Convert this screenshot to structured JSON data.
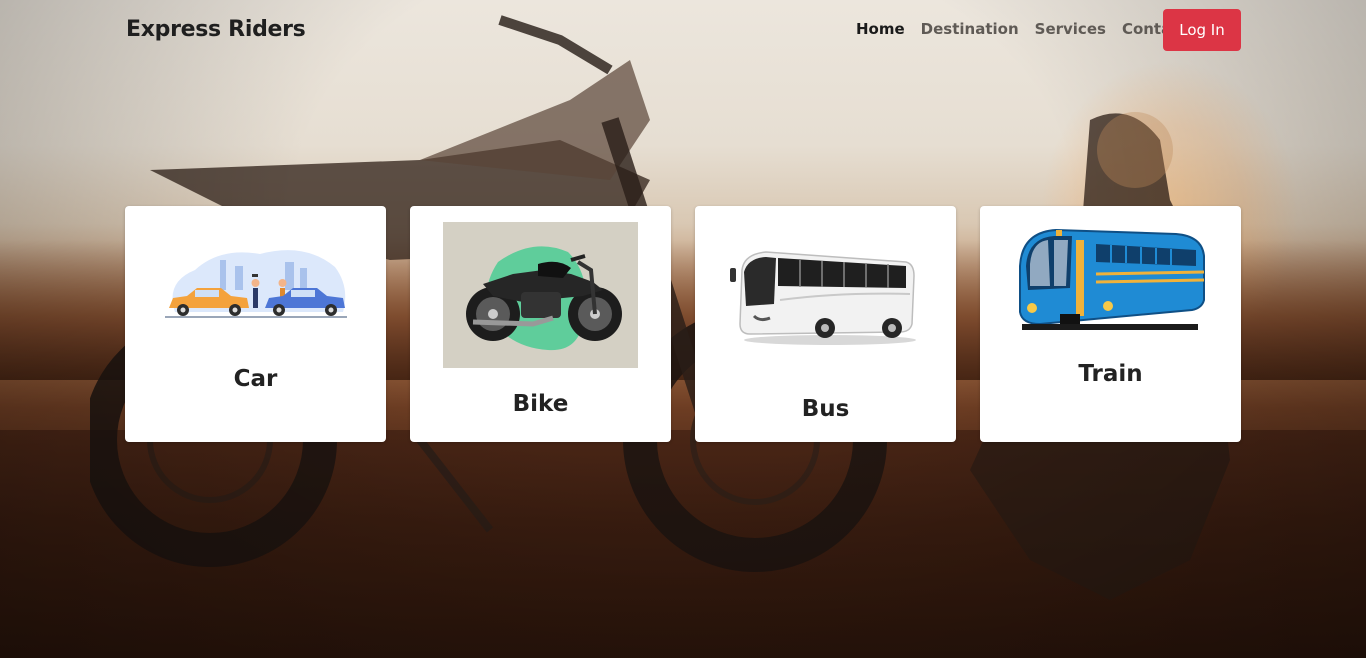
{
  "navbar": {
    "brand": "Express Riders",
    "links": [
      {
        "label": "Home",
        "active": true
      },
      {
        "label": "Destination",
        "active": false
      },
      {
        "label": "Services",
        "active": false
      },
      {
        "label": "Contact",
        "active": false
      }
    ],
    "login_label": "Log In"
  },
  "cards": [
    {
      "title": "Car",
      "icon": "car-illustration"
    },
    {
      "title": "Bike",
      "icon": "motorbike-illustration"
    },
    {
      "title": "Bus",
      "icon": "bus-illustration"
    },
    {
      "title": "Train",
      "icon": "train-illustration"
    }
  ],
  "colors": {
    "accent": "#dc3545",
    "brand_text": "#1f1f1f",
    "nav_text": "#5f5a55",
    "card_bg": "#ffffff"
  }
}
